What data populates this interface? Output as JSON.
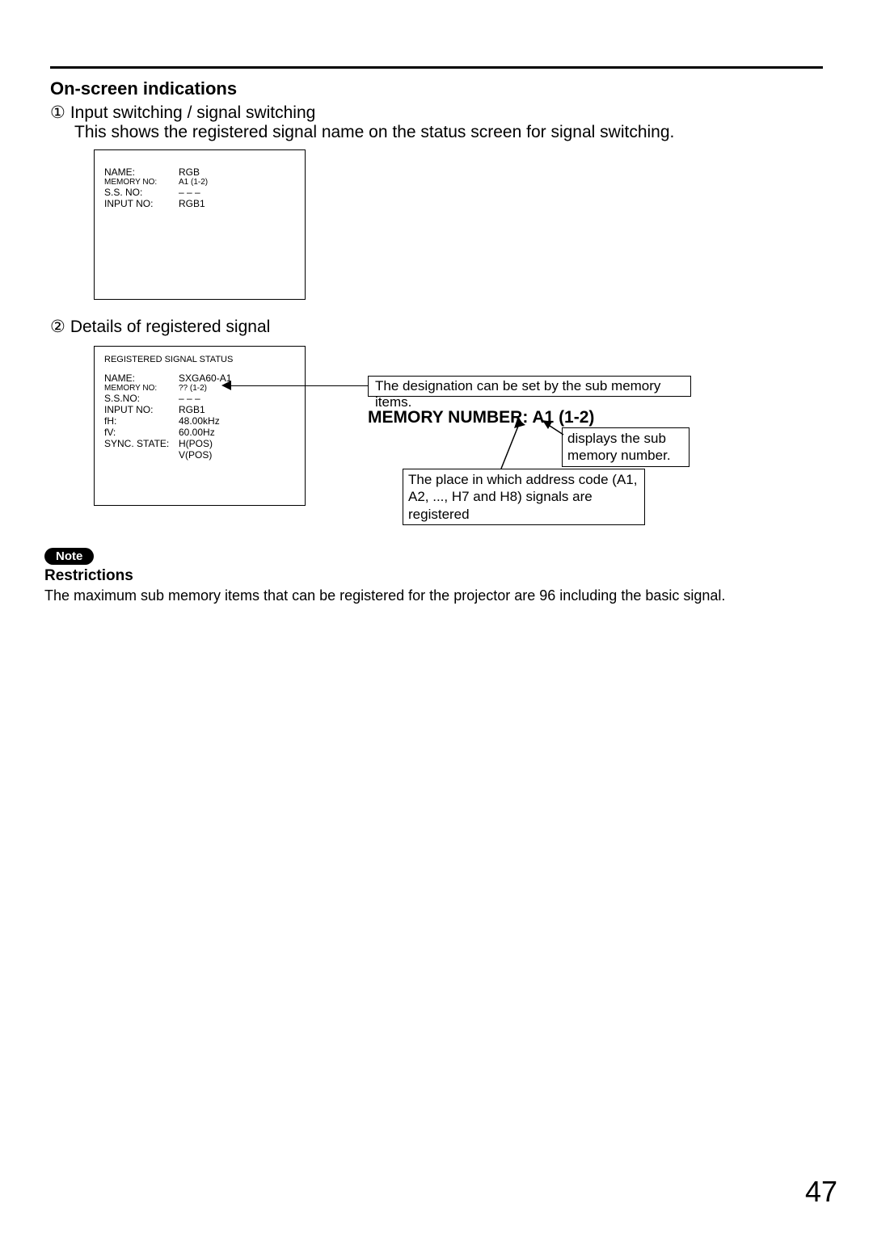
{
  "section_title": "On-screen indications",
  "item1_number": "①",
  "item1_label": "Input switching / signal switching",
  "item1_desc": "This shows the registered signal name on the status screen for signal switching.",
  "box1": {
    "rows": [
      {
        "label": "NAME:",
        "value": "RGB",
        "small": false
      },
      {
        "label": "MEMORY NO:",
        "value": "A1 (1-2)",
        "small": true
      },
      {
        "label": "S.S. NO:",
        "value": "– – –",
        "small": false
      },
      {
        "label": "INPUT NO:",
        "value": "RGB1",
        "small": false
      }
    ]
  },
  "item2_number": "②",
  "item2_label": "Details of registered signal",
  "box2": {
    "title": "REGISTERED SIGNAL STATUS",
    "rows": [
      {
        "label": "NAME:",
        "value": "SXGA60-A1",
        "small": false
      },
      {
        "label": "MEMORY NO:",
        "value": "?? (1-2)",
        "small": true
      },
      {
        "label": "S.S.NO:",
        "value": "– – –",
        "small": false
      },
      {
        "label": "INPUT NO:",
        "value": "RGB1",
        "small": false
      },
      {
        "label": "fH:",
        "value": "48.00kHz",
        "small": false
      },
      {
        "label": "fV:",
        "value": "60.00Hz",
        "small": false
      },
      {
        "label": "SYNC. STATE:",
        "value": "H(POS)",
        "small": false
      },
      {
        "label": "",
        "value": "V(POS)",
        "small": false
      }
    ]
  },
  "callout_designation": "The designation can be set by the sub memory items.",
  "memory_line": "MEMORY NUMBER: A1 (1-2)",
  "callout_right": "displays the sub memory number.",
  "callout_bottom": "The place in which address code (A1, A2, ..., H7 and H8) signals are registered",
  "note_label": "Note",
  "restrictions_title": "Restrictions",
  "restrictions_body": "The maximum sub memory items that can be registered for the projector are 96 including the basic signal.",
  "page_number": "47"
}
